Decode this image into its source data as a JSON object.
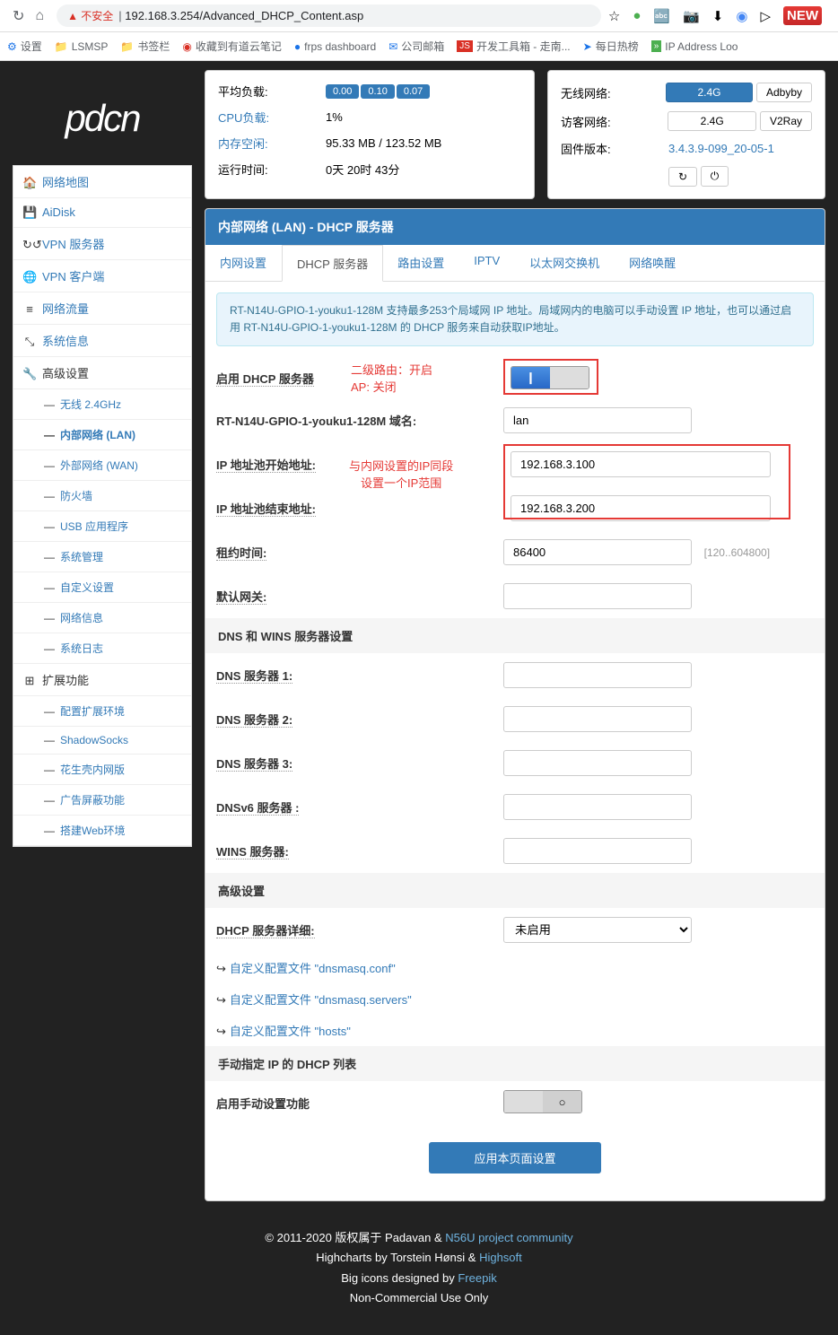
{
  "browser": {
    "insecure_label": "▲ 不安全",
    "url": "192.168.3.254/Advanced_DHCP_Content.asp"
  },
  "bookmarks": [
    "设置",
    "LSMSP",
    "书签栏",
    "收藏到有道云笔记",
    "frps dashboard",
    "公司邮箱",
    "开发工具箱 - 走南...",
    "每日热榜",
    "IP Address Loo"
  ],
  "logo": "pdcn",
  "sidebar": {
    "main": [
      {
        "icon": "🏠",
        "label": "网络地图"
      },
      {
        "icon": "💾",
        "label": "AiDisk"
      },
      {
        "icon": "↻↺",
        "label": "VPN 服务器"
      },
      {
        "icon": "🌐",
        "label": "VPN 客户端"
      },
      {
        "icon": "≡",
        "label": "网络流量"
      },
      {
        "icon": "⤡",
        "label": "系统信息"
      },
      {
        "icon": "🔧",
        "label": "高级设置",
        "head": true
      }
    ],
    "adv": [
      "无线 2.4GHz",
      "内部网络 (LAN)",
      "外部网络 (WAN)",
      "防火墙",
      "USB 应用程序",
      "系统管理",
      "自定义设置",
      "网络信息",
      "系统日志"
    ],
    "ext_head": {
      "icon": "⊞",
      "label": "扩展功能"
    },
    "ext": [
      "配置扩展环境",
      "ShadowSocks",
      "花生壳内网版",
      "广告屏蔽功能",
      "搭建Web环境"
    ]
  },
  "status_left": {
    "rows": [
      {
        "label": "平均负载:",
        "link": false
      },
      {
        "label": "CPU负载:",
        "link": true,
        "value": "1%"
      },
      {
        "label": "内存空闲:",
        "link": true,
        "value": "95.33 MB / 123.52 MB"
      },
      {
        "label": "运行时间:",
        "link": false,
        "value": "0天 20时 43分"
      }
    ],
    "load": [
      "0.00",
      "0.10",
      "0.07"
    ]
  },
  "status_right": {
    "wireless": "无线网络:",
    "wireless_btn": "2.4G",
    "adbyby": "Adbyby",
    "guest": "访客网络:",
    "guest_btn": "2.4G",
    "v2ray": "V2Ray",
    "fw": "固件版本:",
    "fw_val": "3.4.3.9-099_20-05-1"
  },
  "panel": {
    "title": "内部网络 (LAN) - DHCP 服务器",
    "tabs": [
      "内网设置",
      "DHCP 服务器",
      "路由设置",
      "IPTV",
      "以太网交换机",
      "网络唤醒"
    ],
    "info": "RT-N14U-GPIO-1-youku1-128M 支持最多253个局域网 IP 地址。局域网内的电脑可以手动设置 IP 地址，也可以通过启用 RT-N14U-GPIO-1-youku1-128M 的 DHCP 服务来自动获取IP地址。"
  },
  "annotations": {
    "enable_note": "二级路由：开启\nAP: 关闭",
    "pool_note": "与内网设置的IP同段\n设置一个IP范围"
  },
  "form": {
    "enable": "启用 DHCP 服务器",
    "domain": "RT-N14U-GPIO-1-youku1-128M 域名:",
    "domain_val": "lan",
    "pool_start": "IP 地址池开始地址:",
    "pool_start_val": "192.168.3.100",
    "pool_end": "IP 地址池结束地址:",
    "pool_end_val": "192.168.3.200",
    "lease": "租约时间:",
    "lease_val": "86400",
    "lease_hint": "[120..604800]",
    "gateway": "默认网关:",
    "dns_head": "DNS 和 WINS 服务器设置",
    "dns1": "DNS 服务器 1:",
    "dns2": "DNS 服务器 2:",
    "dns3": "DNS 服务器 3:",
    "dnsv6": "DNSv6 服务器 :",
    "wins": "WINS 服务器:",
    "adv_head": "高级设置",
    "detail": "DHCP 服务器详细:",
    "detail_val": "未启用",
    "cfg1": "自定义配置文件 \"dnsmasq.conf\"",
    "cfg2": "自定义配置文件 \"dnsmasq.servers\"",
    "cfg3": "自定义配置文件 \"hosts\"",
    "manual_head": "手动指定 IP 的 DHCP 列表",
    "manual_enable": "启用手动设置功能",
    "apply": "应用本页面设置"
  },
  "footer": {
    "l1a": "© 2011-2020 版权属于 Padavan & ",
    "l1b": "N56U project community",
    "l2a": "Highcharts by Torstein Hønsi & ",
    "l2b": "Highsoft",
    "l3a": "Big icons designed by ",
    "l3b": "Freepik",
    "l4": "Non-Commercial Use Only"
  }
}
